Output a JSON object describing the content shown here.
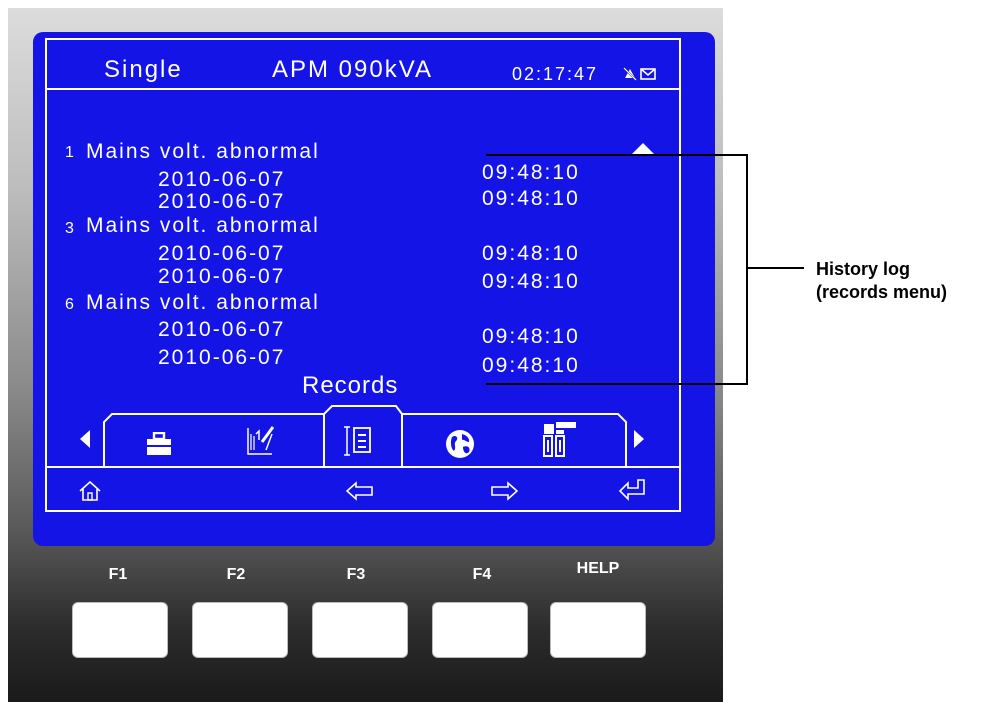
{
  "header": {
    "mode": "Single",
    "model": "APM 090kVA",
    "time": "02:17:47"
  },
  "records": [
    {
      "index": "1",
      "event": "Mains volt. abnormal",
      "entries": [
        {
          "date": "2010-06-07",
          "time": "09:48:10"
        },
        {
          "date": "2010-06-07",
          "time": "09:48:10"
        }
      ]
    },
    {
      "index": "3",
      "event": "Mains volt. abnormal",
      "entries": [
        {
          "date": "2010-06-07",
          "time": "09:48:10"
        },
        {
          "date": "2010-06-07",
          "time": "09:48:10"
        }
      ]
    },
    {
      "index": "6",
      "event": "Mains volt. abnormal",
      "entries": [
        {
          "date": "2010-06-07",
          "time": "09:48:10"
        },
        {
          "date": "2010-06-07",
          "time": "09:48:10"
        }
      ]
    }
  ],
  "menu_title": "Records",
  "tab_icons": [
    "briefcase-icon",
    "settings-chart-icon",
    "records-icon",
    "globe-icon",
    "tools-icon"
  ],
  "selected_tab": "records-icon",
  "softkeys": [
    "home-icon",
    "arrow-left-icon",
    "arrow-right-icon",
    "enter-icon"
  ],
  "function_keys": {
    "f1": "F1",
    "f2": "F2",
    "f3": "F3",
    "f4": "F4",
    "help": "HELP"
  },
  "callout": {
    "line1": "History log",
    "line2": "(records menu)"
  },
  "colors": {
    "lcd_blue": "#1414e6",
    "lcd_text": "#ffffff"
  }
}
